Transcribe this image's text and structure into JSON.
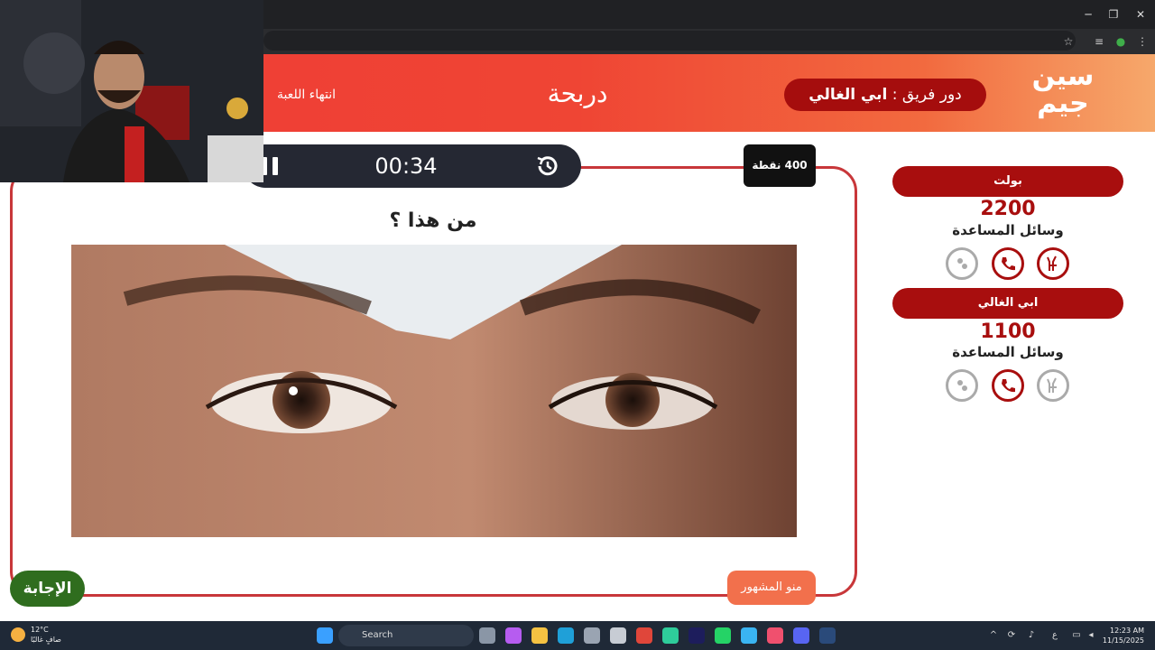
{
  "header": {
    "turn_prefix": "دور فريق :",
    "turn_team": "ابي الغالي",
    "category": "دربحة",
    "end_game": "انتهاء اللعبة",
    "logo_line1": "سين",
    "logo_line2": "جيم"
  },
  "question_card": {
    "timer": "00:34",
    "points": "400 نقطة",
    "question": "من هذا ؟",
    "reveal_button": "منو المشهور",
    "answer_button": "الإجابة"
  },
  "teams": [
    {
      "name": "بولت",
      "score": "2200",
      "helpers_label": "وسائل المساعدة",
      "helpers": [
        {
          "icon": "two-answers-icon",
          "used": false
        },
        {
          "icon": "phone-icon",
          "used": false
        },
        {
          "icon": "hole-icon",
          "used": true
        }
      ]
    },
    {
      "name": "ابي الغالي",
      "score": "1100",
      "helpers_label": "وسائل المساعدة",
      "helpers": [
        {
          "icon": "two-answers-icon",
          "used": true
        },
        {
          "icon": "phone-icon",
          "used": false
        },
        {
          "icon": "hole-icon",
          "used": true
        }
      ]
    }
  ],
  "taskbar": {
    "temperature": "12°C",
    "weather": "صافٍ غالبًا",
    "search": "Search",
    "time": "12:23 AM",
    "date": "11/15/2025",
    "lang": "ع"
  },
  "colors": {
    "accent": "#a80e0e",
    "header_start": "#ef3b36",
    "header_end": "#f6a86b",
    "answer_green": "#2f6d1e",
    "reveal_orange": "#f2704c"
  }
}
